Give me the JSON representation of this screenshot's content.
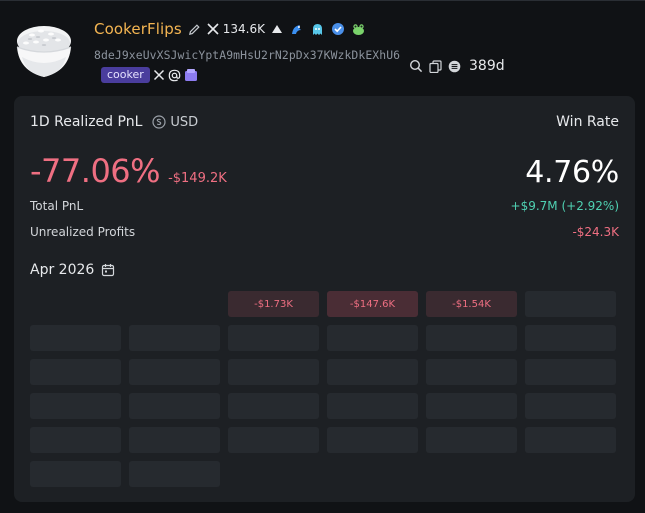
{
  "profile": {
    "name": "CookerFlips",
    "x_followers": "134.6K",
    "address": "8deJ9xeUvXSJwicYptA9mHsU2rN2pDx37KWzkDkEXhU6",
    "tag": "cooker",
    "days": "389d",
    "colors": {
      "name": "#f4b552",
      "tag_bg": "#4a3d9d"
    }
  },
  "pnl_card": {
    "title": "1D Realized PnL",
    "currency": "USD",
    "win_rate_label": "Win Rate",
    "realized_pct": "-77.06%",
    "realized_usd": "-$149.2K",
    "win_rate": "4.76%",
    "total_pnl_label": "Total PnL",
    "total_pnl_value": "+$9.7M (+2.92%)",
    "unrealized_label": "Unrealized Profits",
    "unrealized_value": "-$24.3K",
    "colors": {
      "negative": "#ef6f82",
      "positive": "#4fd1b2"
    }
  },
  "calendar": {
    "month": "Apr 2026",
    "rows": [
      [
        "",
        "",
        "-$1.73K",
        "-$147.6K",
        "-$1.54K",
        ""
      ],
      [
        "",
        "",
        "",
        "",
        "",
        ""
      ],
      [
        "",
        "",
        "",
        "",
        "",
        ""
      ],
      [
        "",
        "",
        "",
        "",
        "",
        ""
      ],
      [
        "",
        "",
        "",
        "",
        "",
        ""
      ],
      [
        "",
        ""
      ]
    ]
  }
}
